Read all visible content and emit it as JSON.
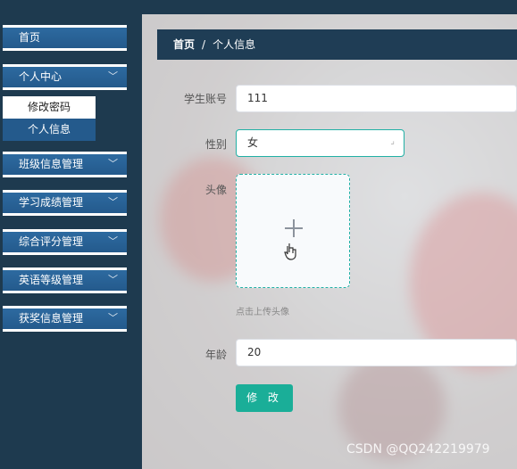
{
  "sidebar": {
    "home": "首页",
    "personal_center": "个人中心",
    "submenu": [
      "修改密码",
      "个人信息"
    ],
    "items": [
      "班级信息管理",
      "学习成绩管理",
      "综合评分管理",
      "英语等级管理",
      "获奖信息管理"
    ]
  },
  "breadcrumb": {
    "home": "首页",
    "sep": "/",
    "current": "个人信息"
  },
  "form": {
    "account_label": "学生账号",
    "account_value": "111",
    "gender_label": "性别",
    "gender_value": "女",
    "avatar_label": "头像",
    "avatar_hint": "点击上传头像",
    "age_label": "年龄",
    "age_value": "20",
    "submit_label": "修 改"
  },
  "watermark": "CSDN @QQ242219979",
  "colors": {
    "sidebar": "#1e3a4f",
    "menu": "#245a8c",
    "accent": "#1aae98"
  }
}
